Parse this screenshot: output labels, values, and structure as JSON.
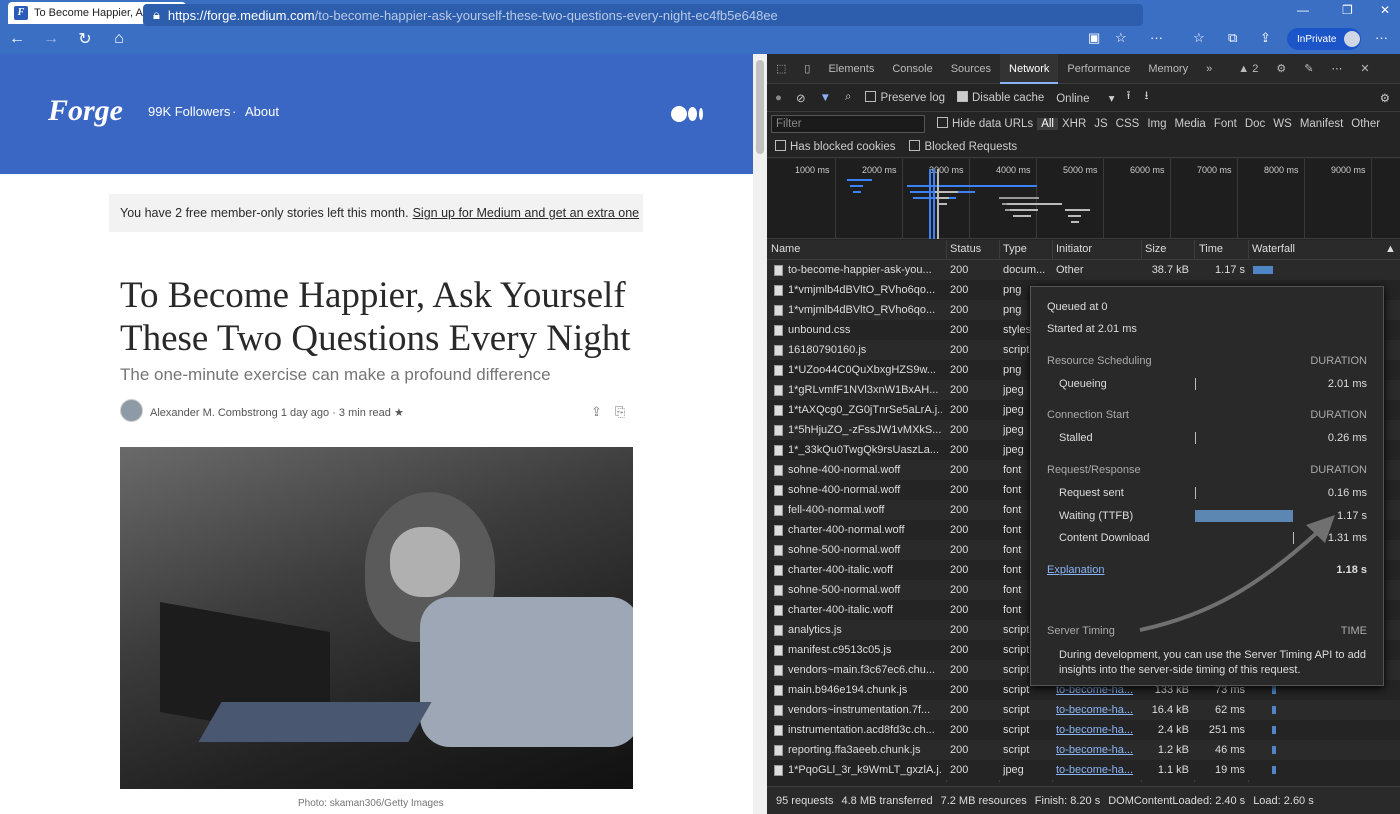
{
  "browser": {
    "tab_title": "To Become Happier, Ask Yourself",
    "tab_favicon": "F",
    "url_host": "https://forge.medium.com",
    "url_path": "/to-become-happier-ask-yourself-these-two-questions-every-night-ec4fb5e648ee",
    "inprivate_label": "InPrivate"
  },
  "page": {
    "pub_logo": "Forge",
    "followers": "99K Followers",
    "about": "About",
    "member_text": "You have 2 free member-only stories left this month.",
    "member_link": "Sign up for Medium and get an extra one",
    "title": "To Become Happier, Ask Yourself These Two Questions Every Night",
    "subtitle": "The one-minute exercise can make a profound difference",
    "author_line": "Alexander M. Combstrong  1 day ago · 3 min read ★",
    "caption": "Photo: skaman306/Getty Images"
  },
  "devtools": {
    "tabs": [
      "Elements",
      "Console",
      "Sources",
      "Network",
      "Performance",
      "Memory"
    ],
    "active_tab": "Network",
    "issues": "2",
    "preserve_log": "Preserve log",
    "disable_cache": "Disable cache",
    "throttle": "Online",
    "filter_placeholder": "Filter",
    "hide_data_urls": "Hide data URLs",
    "filter_types": [
      "All",
      "XHR",
      "JS",
      "CSS",
      "Img",
      "Media",
      "Font",
      "Doc",
      "WS",
      "Manifest",
      "Other"
    ],
    "has_blocked_cookies": "Has blocked cookies",
    "blocked_requests": "Blocked Requests",
    "ticks": [
      "1000 ms",
      "2000 ms",
      "3000 ms",
      "4000 ms",
      "5000 ms",
      "6000 ms",
      "7000 ms",
      "8000 ms",
      "9000 ms"
    ],
    "columns": {
      "name": "Name",
      "status": "Status",
      "type": "Type",
      "initiator": "Initiator",
      "size": "Size",
      "time": "Time",
      "waterfall": "Waterfall"
    },
    "rows": [
      {
        "name": "to-become-happier-ask-you...",
        "status": "200",
        "type": "docum...",
        "initiator": "Other",
        "size": "38.7 kB",
        "time": "1.17 s",
        "link": false
      },
      {
        "name": "1*vmjmlb4dBVltO_RVho6qo...",
        "status": "200",
        "type": "png",
        "initiator": "",
        "size": "",
        "time": "",
        "link": false
      },
      {
        "name": "1*vmjmlb4dBVltO_RVho6qo...",
        "status": "200",
        "type": "png",
        "initiator": "",
        "size": "",
        "time": "",
        "link": false
      },
      {
        "name": "unbound.css",
        "status": "200",
        "type": "styles",
        "initiator": "",
        "size": "",
        "time": "",
        "link": false
      },
      {
        "name": "16180790160.js",
        "status": "200",
        "type": "script",
        "initiator": "",
        "size": "",
        "time": "",
        "link": false
      },
      {
        "name": "1*UZoo44C0QuXbxgHZS9w...",
        "status": "200",
        "type": "png",
        "initiator": "",
        "size": "",
        "time": "",
        "link": false
      },
      {
        "name": "1*gRLvmfF1NVl3xnW1BxAH...",
        "status": "200",
        "type": "jpeg",
        "initiator": "",
        "size": "",
        "time": "",
        "link": false
      },
      {
        "name": "1*tAXQcg0_ZG0jTnrSe5aLrA.j...",
        "status": "200",
        "type": "jpeg",
        "initiator": "",
        "size": "",
        "time": "",
        "link": false
      },
      {
        "name": "1*5hHjuZO_-zFssJW1vMXkS...",
        "status": "200",
        "type": "jpeg",
        "initiator": "",
        "size": "",
        "time": "",
        "link": false
      },
      {
        "name": "1*_33kQu0TwgQk9rsUaszLa...",
        "status": "200",
        "type": "jpeg",
        "initiator": "",
        "size": "",
        "time": "",
        "link": false
      },
      {
        "name": "sohne-400-normal.woff",
        "status": "200",
        "type": "font",
        "initiator": "",
        "size": "",
        "time": "",
        "link": false
      },
      {
        "name": "sohne-400-normal.woff",
        "status": "200",
        "type": "font",
        "initiator": "",
        "size": "",
        "time": "",
        "link": false
      },
      {
        "name": "fell-400-normal.woff",
        "status": "200",
        "type": "font",
        "initiator": "",
        "size": "",
        "time": "",
        "link": false
      },
      {
        "name": "charter-400-normal.woff",
        "status": "200",
        "type": "font",
        "initiator": "",
        "size": "",
        "time": "",
        "link": false
      },
      {
        "name": "sohne-500-normal.woff",
        "status": "200",
        "type": "font",
        "initiator": "",
        "size": "",
        "time": "",
        "link": false
      },
      {
        "name": "charter-400-italic.woff",
        "status": "200",
        "type": "font",
        "initiator": "",
        "size": "",
        "time": "",
        "link": false
      },
      {
        "name": "sohne-500-normal.woff",
        "status": "200",
        "type": "font",
        "initiator": "",
        "size": "",
        "time": "",
        "link": false
      },
      {
        "name": "charter-400-italic.woff",
        "status": "200",
        "type": "font",
        "initiator": "",
        "size": "",
        "time": "",
        "link": false
      },
      {
        "name": "analytics.js",
        "status": "200",
        "type": "script",
        "initiator": "",
        "size": "",
        "time": "",
        "link": false
      },
      {
        "name": "manifest.c9513c05.js",
        "status": "200",
        "type": "script",
        "initiator": "",
        "size": "",
        "time": "",
        "link": false
      },
      {
        "name": "vendors~main.f3c67ec6.chu...",
        "status": "200",
        "type": "script",
        "initiator": "",
        "size": "",
        "time": "",
        "link": false
      },
      {
        "name": "main.b946e194.chunk.js",
        "status": "200",
        "type": "script",
        "initiator": "to-become-ha...",
        "size": "133 kB",
        "time": "73 ms",
        "link": true
      },
      {
        "name": "vendors~instrumentation.7f...",
        "status": "200",
        "type": "script",
        "initiator": "to-become-ha...",
        "size": "16.4 kB",
        "time": "62 ms",
        "link": true
      },
      {
        "name": "instrumentation.acd8fd3c.ch...",
        "status": "200",
        "type": "script",
        "initiator": "to-become-ha...",
        "size": "2.4 kB",
        "time": "251 ms",
        "link": true
      },
      {
        "name": "reporting.ffa3aeeb.chunk.js",
        "status": "200",
        "type": "script",
        "initiator": "to-become-ha...",
        "size": "1.2 kB",
        "time": "46 ms",
        "link": true
      },
      {
        "name": "1*PqoGLl_3r_k9WmLT_gxzlA.j...",
        "status": "200",
        "type": "jpeg",
        "initiator": "to-become-ha...",
        "size": "1.1 kB",
        "time": "19 ms",
        "link": true
      }
    ],
    "popover": {
      "queued": "Queued at 0",
      "started": "Started at 2.01 ms",
      "duration": "DURATION",
      "sched_hdr": "Resource Scheduling",
      "queueing": "Queueing",
      "queueing_v": "2.01 ms",
      "conn_hdr": "Connection Start",
      "stalled": "Stalled",
      "stalled_v": "0.26 ms",
      "req_hdr": "Request/Response",
      "sent": "Request sent",
      "sent_v": "0.16 ms",
      "ttfb": "Waiting (TTFB)",
      "ttfb_v": "1.17 s",
      "download": "Content Download",
      "download_v": "1.31 ms",
      "explanation": "Explanation",
      "total": "1.18 s",
      "server_hdr": "Server Timing",
      "time": "TIME",
      "note": "During development, you can use the Server Timing API to add insights into the server-side timing of this request."
    },
    "status_bar": [
      "95 requests",
      "4.8 MB transferred",
      "7.2 MB resources",
      "Finish: 8.20 s",
      "DOMContentLoaded: 2.40 s",
      "Load: 2.60 s"
    ]
  }
}
